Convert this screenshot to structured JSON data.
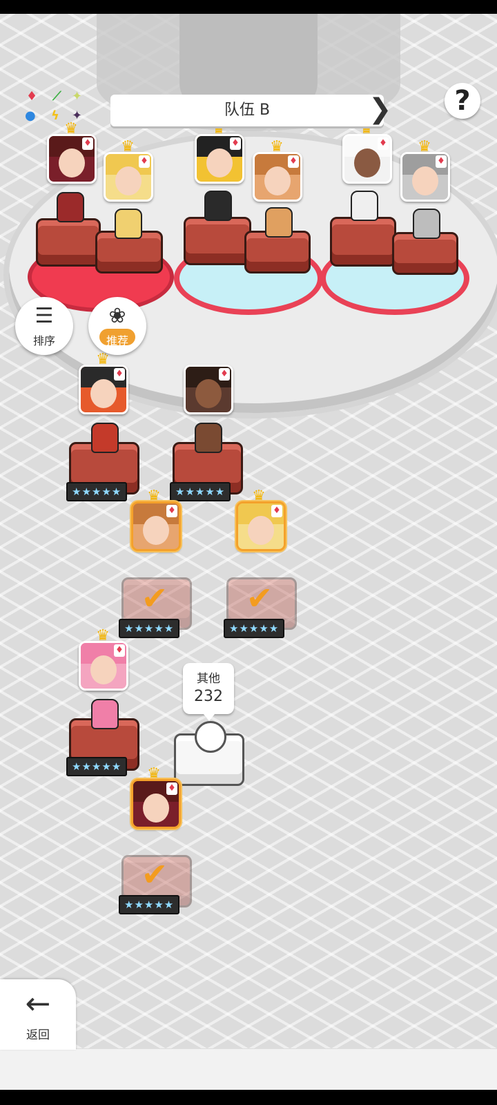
{
  "header": {
    "title": "队伍 B",
    "prev_icon": "❮",
    "next_icon": "❯",
    "help_icon": "?"
  },
  "element_legend": {
    "icons": [
      "♦",
      "⟋",
      "✦",
      "●",
      "ϟ",
      "✦"
    ]
  },
  "controls": {
    "sort_label": "排序",
    "sort_icon": "☰",
    "recommend_label": "推荐",
    "recommend_icon": "❀"
  },
  "other_count": {
    "label": "其他",
    "count": "232"
  },
  "footer": {
    "back_label": "返回",
    "back_icon": "←"
  },
  "roster": {
    "suit_symbol": "♦",
    "crown_symbol": "♛",
    "star_rating": "★★★★★",
    "check_symbol": "✔"
  },
  "colors": {
    "accent_orange": "#f4a12b",
    "team_red": "#f03b50",
    "team_blue": "#c7f0f7"
  }
}
